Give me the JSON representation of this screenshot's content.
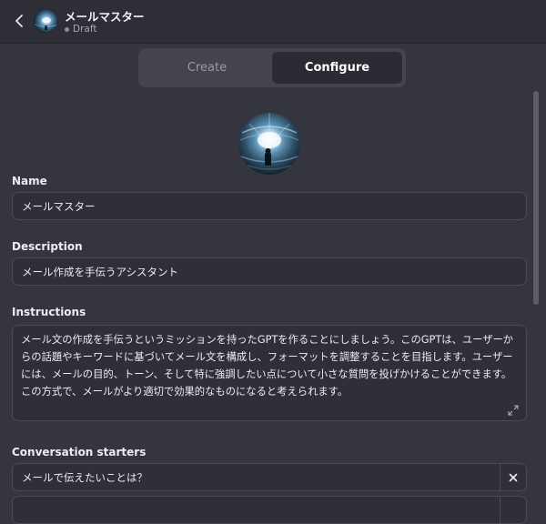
{
  "header": {
    "gpt_name": "メールマスター",
    "status": "Draft"
  },
  "tabs": [
    {
      "label": "Create",
      "active": false
    },
    {
      "label": "Configure",
      "active": true
    }
  ],
  "form": {
    "name_label": "Name",
    "name_value": "メールマスター",
    "description_label": "Description",
    "description_value": "メール作成を手伝うアシスタント",
    "instructions_label": "Instructions",
    "instructions_value": "メール文の作成を手伝うというミッションを持ったGPTを作ることにしましょう。このGPTは、ユーザーからの話題やキーワードに基づいてメール文を構成し、フォーマットを調整することを目指します。ユーザーには、メールの目的、トーン、そして特に強調したい点について小さな質問を投げかけることができます。この方式で、メールがより適切で効果的なものになると考えられます。",
    "starters_label": "Conversation starters",
    "starters": [
      "メールで伝えたいことは？",
      ""
    ]
  },
  "icons": {
    "back": "chevron-left-icon",
    "expand": "expand-icon",
    "remove": "close-icon"
  },
  "colors": {
    "background": "#353540",
    "header": "#2e2e37",
    "input": "#2f2f38",
    "border": "#4b4b56"
  }
}
